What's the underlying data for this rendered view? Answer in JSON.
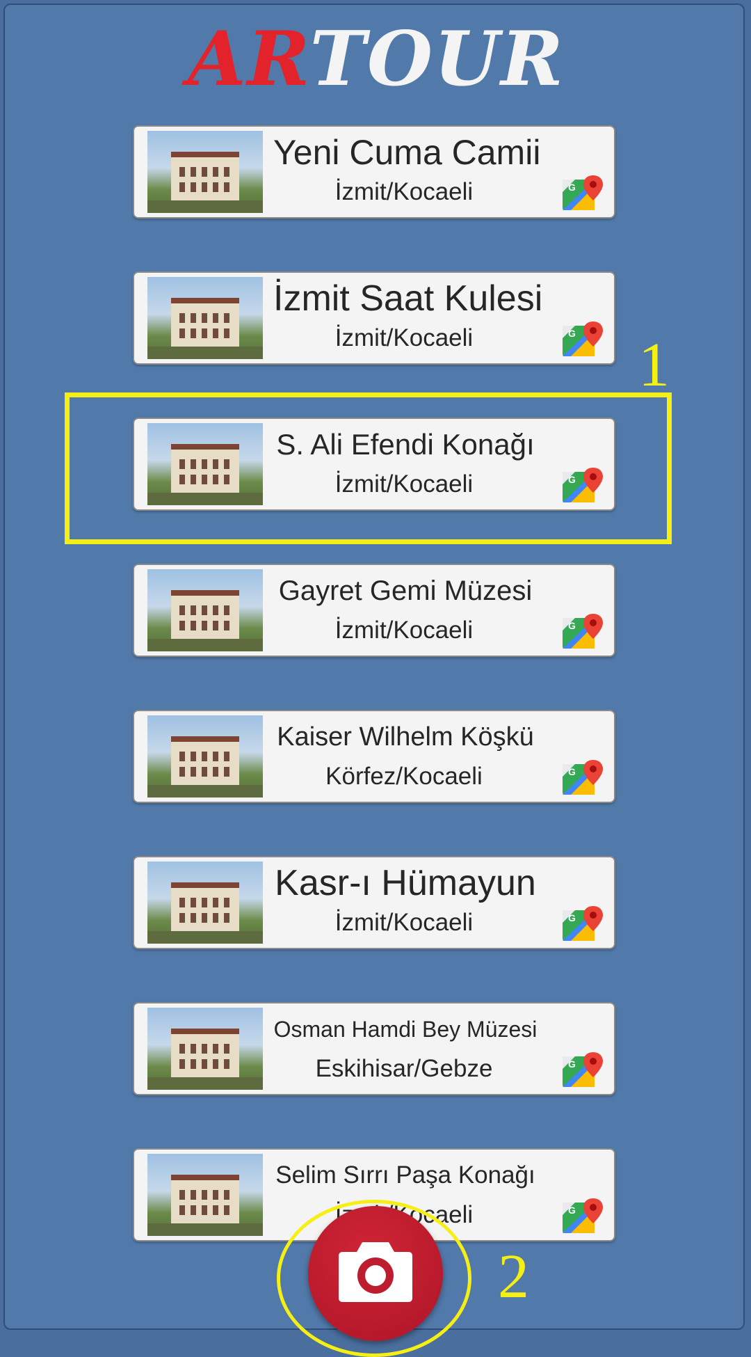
{
  "logo": {
    "part1": "AR",
    "part2": "TOUR",
    "part1_color": "#e3232c",
    "part2_color": "#f4f4f4"
  },
  "places": [
    {
      "name": "Yeni Cuma Camii",
      "location": "İzmit/Kocaeli",
      "title_size": 50
    },
    {
      "name": "İzmit Saat Kulesi",
      "location": "İzmit/Kocaeli",
      "title_size": 52
    },
    {
      "name": "S. Ali Efendi Konağı",
      "location": "İzmit/Kocaeli",
      "title_size": 42
    },
    {
      "name": "Gayret Gemi Müzesi",
      "location": "İzmit/Kocaeli",
      "title_size": 40
    },
    {
      "name": "Kaiser Wilhelm Köşkü",
      "location": "Körfez/Kocaeli",
      "title_size": 38
    },
    {
      "name": "Kasr-ı Hümayun",
      "location": "İzmit/Kocaeli",
      "title_size": 52
    },
    {
      "name": "Osman Hamdi Bey Müzesi",
      "location": "Eskihisar/Gebze",
      "title_size": 32
    },
    {
      "name": "Selim Sırrı Paşa Konağı",
      "location": "İzmit/Kocaeli",
      "title_size": 35
    }
  ],
  "map_icon": "google-maps-icon",
  "camera_icon": "camera-icon",
  "annotations": {
    "label_1": "1",
    "label_2": "2",
    "color": "#f6ef16"
  },
  "camera_button_color": "#c21f30"
}
